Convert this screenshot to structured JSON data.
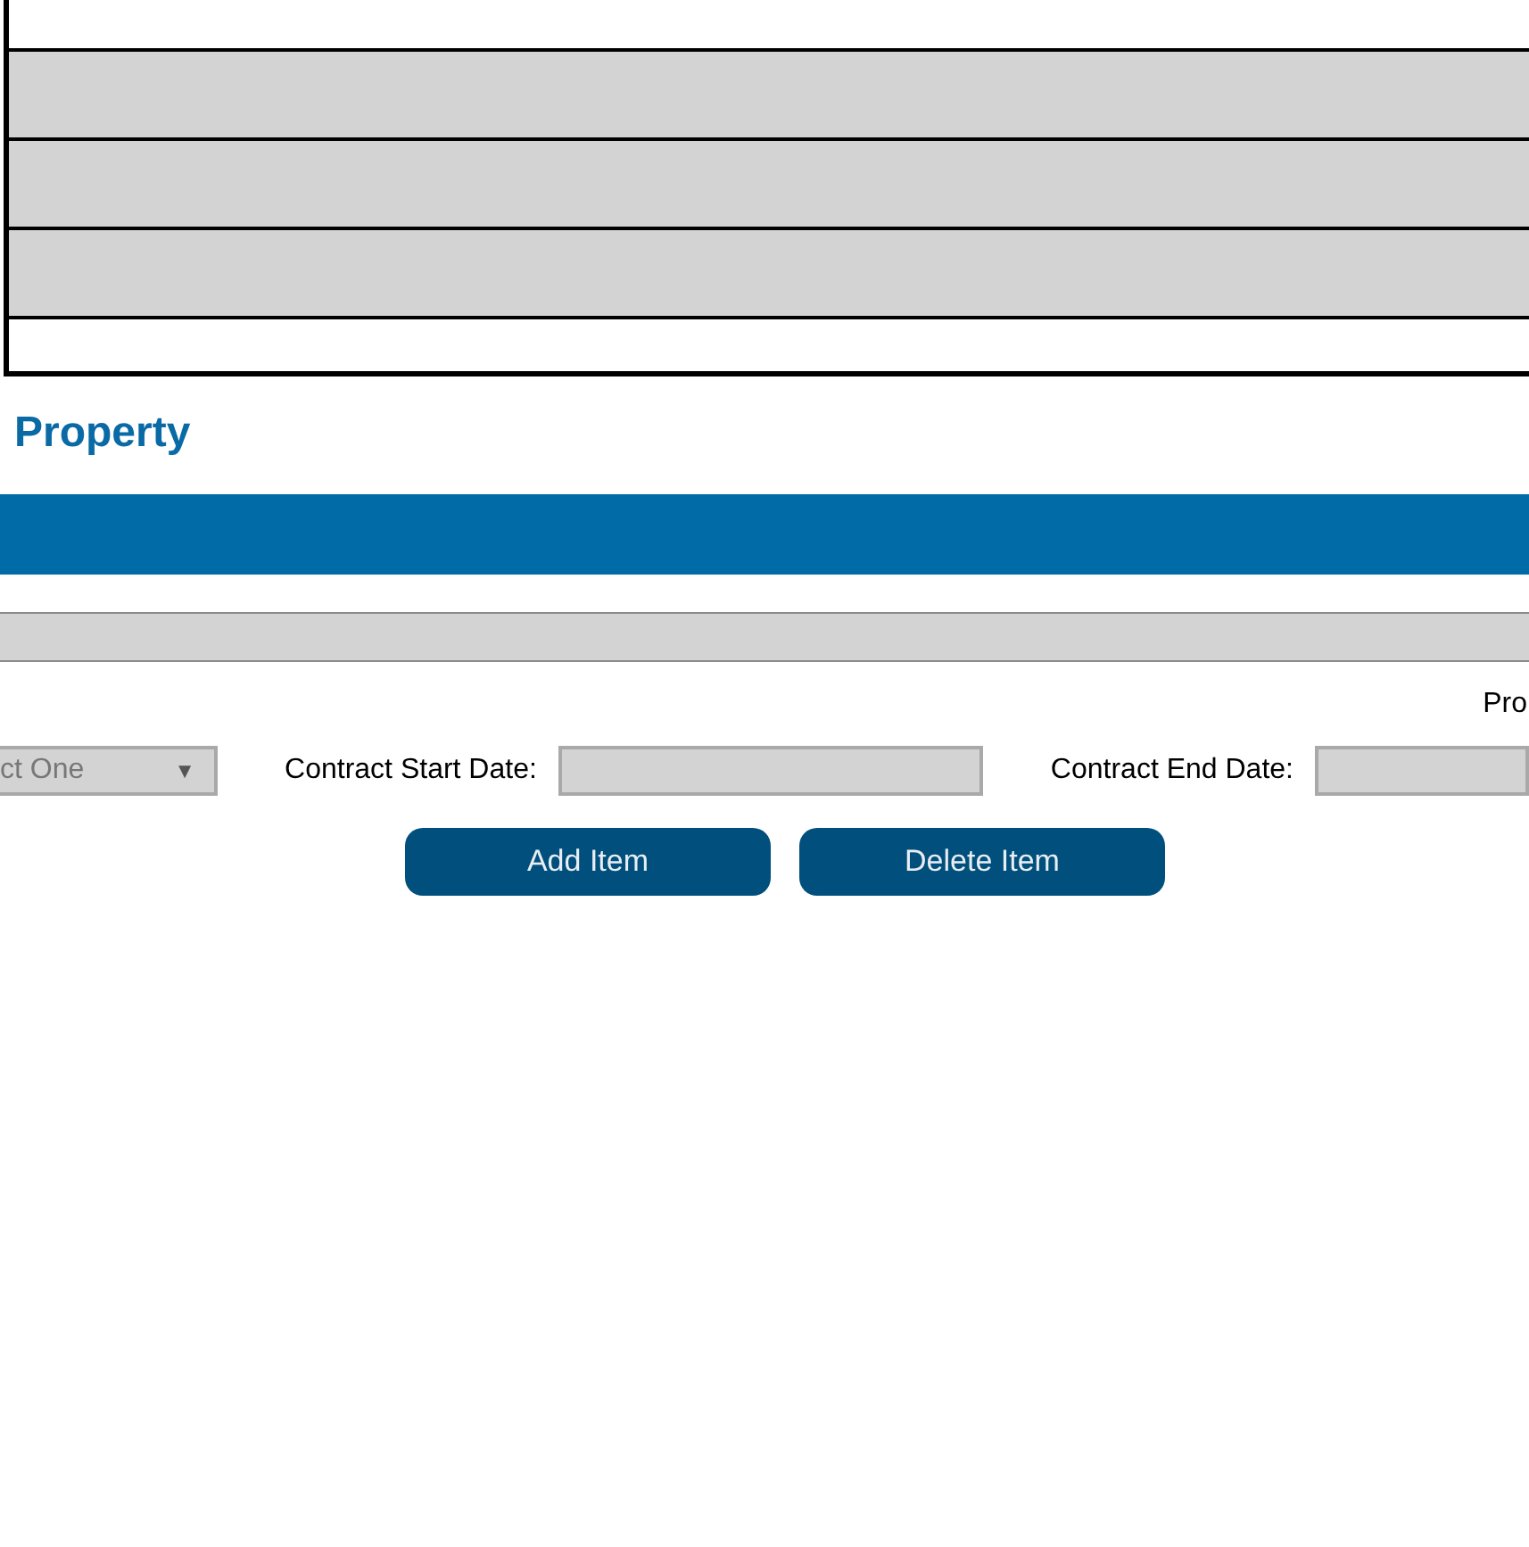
{
  "table": {
    "rows": [
      {
        "shaded": false
      },
      {
        "shaded": true
      },
      {
        "shaded": true
      },
      {
        "shaded": true
      },
      {
        "shaded": false
      }
    ]
  },
  "section": {
    "title": "Property"
  },
  "form": {
    "right_label": "Pro",
    "dropdown": {
      "value": "ct One",
      "arrow": "▼"
    },
    "fields": [
      {
        "label": "Contract Start Date:"
      },
      {
        "label": "Contract End Date:"
      }
    ],
    "buttons": [
      "Add Item",
      "Delete Item"
    ]
  }
}
